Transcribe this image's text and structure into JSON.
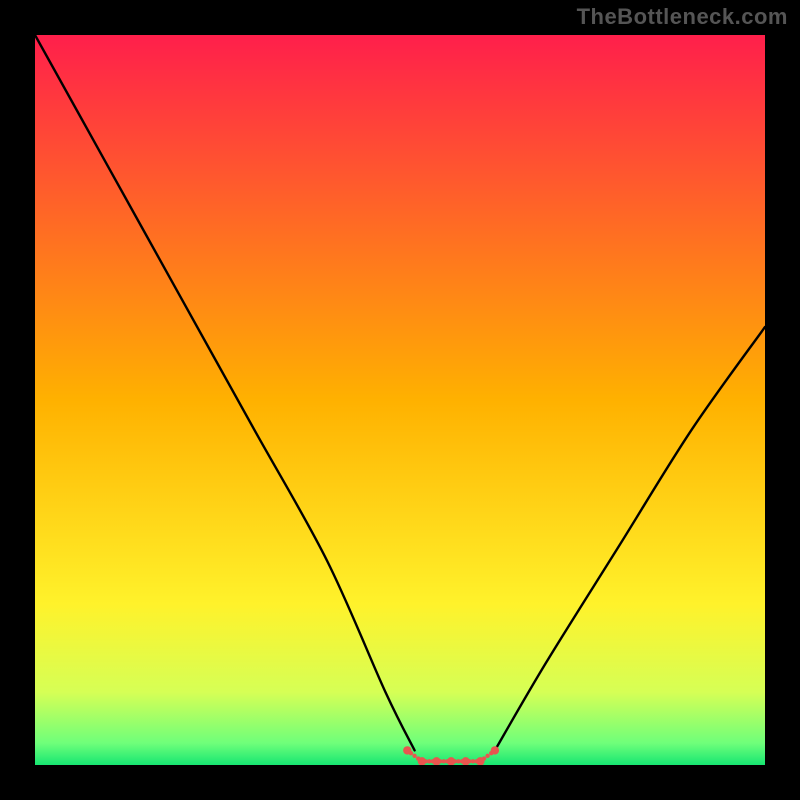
{
  "watermark": "TheBottleneck.com",
  "chart_data": {
    "type": "line",
    "title": "",
    "xlabel": "",
    "ylabel": "",
    "xlim": [
      0,
      100
    ],
    "ylim": [
      0,
      100
    ],
    "series": [
      {
        "name": "curve-left",
        "color": "#000000",
        "x": [
          0,
          10,
          20,
          30,
          40,
          48,
          52
        ],
        "y": [
          100,
          82,
          64,
          46,
          28,
          10,
          2
        ]
      },
      {
        "name": "curve-right",
        "color": "#000000",
        "x": [
          63,
          70,
          80,
          90,
          100
        ],
        "y": [
          2,
          14,
          30,
          46,
          60
        ]
      },
      {
        "name": "bottom-flat",
        "color": "#e8564f",
        "x": [
          51,
          53,
          55,
          57,
          59,
          61,
          63
        ],
        "y": [
          2,
          0.5,
          0.5,
          0.5,
          0.5,
          0.5,
          2
        ]
      }
    ],
    "background_gradient": [
      {
        "offset": 0.0,
        "color": "#ff1f4b"
      },
      {
        "offset": 0.5,
        "color": "#ffb100"
      },
      {
        "offset": 0.78,
        "color": "#fff22b"
      },
      {
        "offset": 0.9,
        "color": "#d6ff55"
      },
      {
        "offset": 0.97,
        "color": "#6fff7a"
      },
      {
        "offset": 1.0,
        "color": "#17e672"
      }
    ],
    "bottom_flat_style": "dotted"
  }
}
